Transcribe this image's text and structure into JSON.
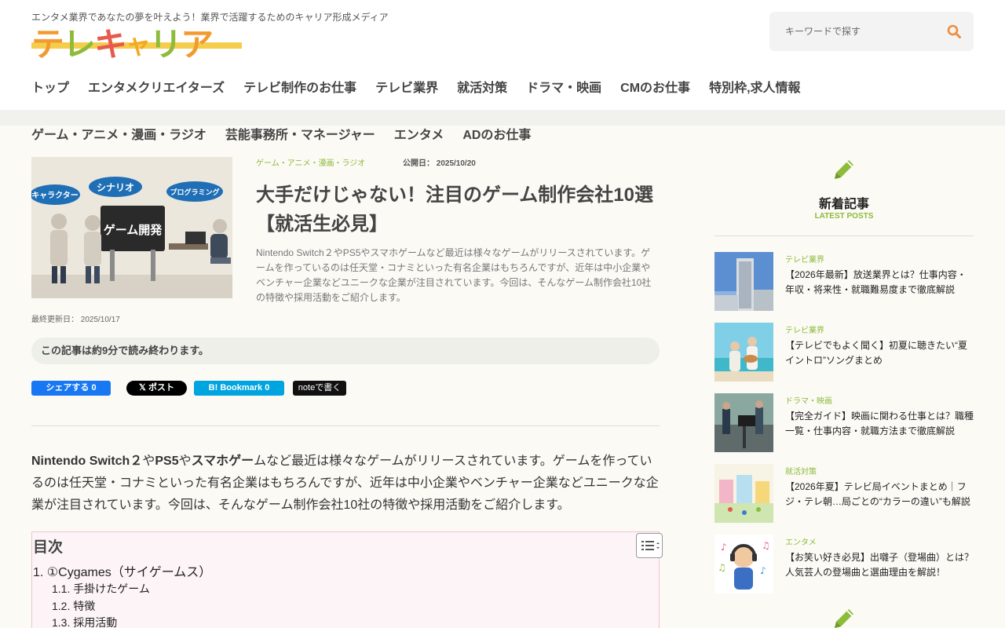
{
  "header": {
    "tagline": "エンタメ業界であなたの夢を叶えよう！業界で活躍するためのキャリア形成メディア",
    "logo_chars": [
      "テ",
      "レ",
      "キ",
      "ャ",
      "リ",
      "ア"
    ],
    "search_placeholder": "キーワードで探す"
  },
  "nav": {
    "row1": [
      "トップ",
      "エンタメクリエイターズ",
      "テレビ制作のお仕事",
      "テレビ業界",
      "就活対策",
      "ドラマ・映画",
      "CMのお仕事",
      "特別枠,求人情報"
    ],
    "row2": [
      "ゲーム・アニメ・漫画・ラジオ",
      "芸能事務所・マネージャー",
      "エンタメ",
      "ADのお仕事"
    ]
  },
  "article": {
    "category": "ゲーム・アニメ・漫画・ラジオ",
    "published_label": "公開日：",
    "published": "2025/10/20",
    "title": "大手だけじゃない！注目のゲーム制作会社10選【就活生必見】",
    "excerpt": "Nintendo Switch２やPS5やスマホゲームなど最近は様々なゲームがリリースされています。ゲームを作っているのは任天堂・コナミといった有名企業はもちろんですが、近年は中小企業やベンチャー企業などユニークな企業が注目されています。今回は、そんなゲーム制作会社10社の特徴や採用活動をご紹介します。",
    "updated_label": "最終更新日：",
    "updated": "2025/10/17",
    "readtime": "この記事は約9分で読み終わります。",
    "thumb_labels": [
      "キャラクター",
      "シナリオ",
      "プログラミング",
      "ゲーム開発"
    ],
    "body_bold1": "Nintendo Switch２",
    "body_1": "や",
    "body_bold2": "PS5",
    "body_2": "や",
    "body_bold3": "スマホゲー",
    "body_3": "ムなど最近は様々なゲームがリリースされています。ゲームを作っているのは任天堂・コナミといった有名企業はもちろんですが、近年は中小企業やベンチャー企業などユニークな企業が注目されています。今回は、そんなゲーム制作会社10社の特徴や採用活動をご紹介します。"
  },
  "share": {
    "facebook": "シェアする 0",
    "x": "𝕏 ポスト",
    "hatena": "B! Bookmark  0",
    "note": "noteで書く"
  },
  "toc": {
    "title": "目次",
    "items": [
      {
        "label": "1. ①Cygames（サイゲームス）"
      },
      {
        "label": "1.1. 手掛けたゲーム"
      },
      {
        "label": "1.2. 特徴"
      },
      {
        "label": "1.3. 採用活動"
      }
    ]
  },
  "sidebar": {
    "title": "新着記事",
    "subtitle": "LATEST POSTS",
    "posts": [
      {
        "category": "テレビ業界",
        "title": "【2026年最新】放送業界とは？仕事内容・年収・将来性・就職難易度まで徹底解説"
      },
      {
        "category": "テレビ業界",
        "title": "【テレビでもよく聞く】初夏に聴きたい“夏イントロ”ソングまとめ"
      },
      {
        "category": "ドラマ・映画",
        "title": "【完全ガイド】映画に関わる仕事とは？職種一覧・仕事内容・就職方法まで徹底解説"
      },
      {
        "category": "就活対策",
        "title": "【2026年夏】テレビ局イベントまとめ｜フジ・テレ朝…局ごとの“カラーの違い”も解説"
      },
      {
        "category": "エンタメ",
        "title": "【お笑い好き必見】出囃子（登場曲）とは？人気芸人の登場曲と選曲理由を解説！"
      }
    ]
  },
  "colors": {
    "accent": "#8dbb3a",
    "search_icon": "#f08c3a",
    "toc_border": "#f0c3d3",
    "logo": [
      "#f29a2e",
      "#8dbb3a",
      "#e85a4f",
      "#f3c11f",
      "#8dbb3a",
      "#f29a2e"
    ]
  }
}
